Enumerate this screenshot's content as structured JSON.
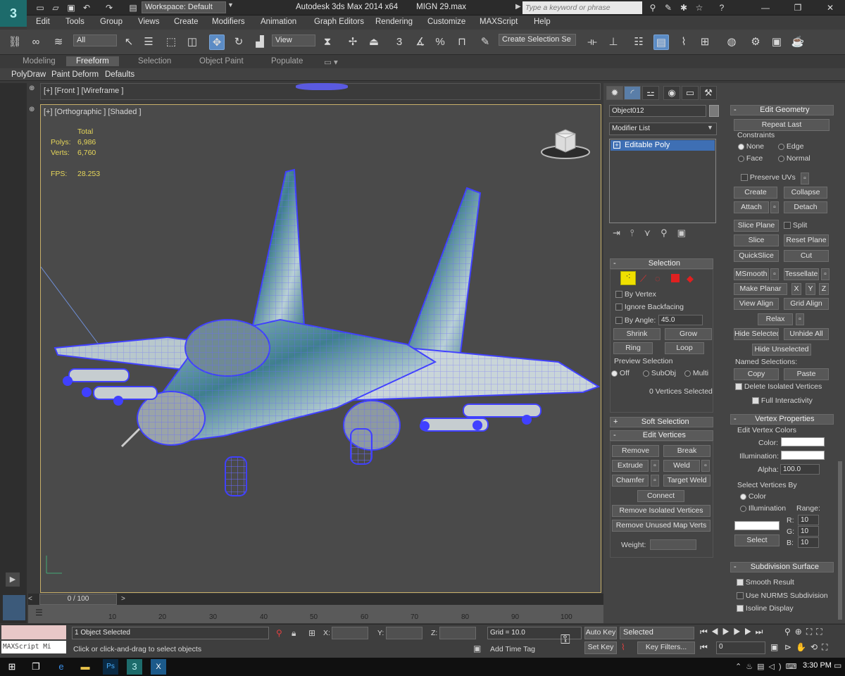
{
  "app": {
    "workspace": "Workspace: Default",
    "window_title": "Autodesk 3ds Max  2014 x64",
    "file": "MIGN 29.max",
    "search_placeholder": "Type a keyword or phrase"
  },
  "menus": [
    "Edit",
    "Tools",
    "Group",
    "Views",
    "Create",
    "Modifiers",
    "Animation",
    "Graph Editors",
    "Rendering",
    "Customize",
    "MAXScript",
    "Help"
  ],
  "toolbar": {
    "selection_filter": "All",
    "ref_coord": "View",
    "named_selection_placeholder": "Create Selection Se",
    "angle_snap": "3",
    "percent_snap": "%"
  },
  "ribbon_tabs": [
    "Modeling",
    "Freeform",
    "Selection",
    "Object Paint",
    "Populate"
  ],
  "ribbon_active": "Freeform",
  "ribbon_sub": [
    "PolyDraw",
    "Paint Deform",
    "Defaults"
  ],
  "viewports": {
    "front_label": "[+] [Front ] [Wireframe ]",
    "main_label": "[+] [Orthographic ] [Shaded ]",
    "stats": {
      "total_label": "Total",
      "polys_label": "Polys:",
      "polys": "6,986",
      "verts_label": "Verts:",
      "verts": "6,760",
      "fps_label": "FPS:",
      "fps": "28.253"
    }
  },
  "command_panel": {
    "object_name": "Object012",
    "modifier_list": "Modifier List",
    "stack_item": "Editable Poly",
    "selection": {
      "title": "Selection",
      "by_vertex": "By Vertex",
      "ignore_backfacing": "Ignore Backfacing",
      "by_angle": "By Angle:",
      "angle_value": "45.0",
      "shrink": "Shrink",
      "grow": "Grow",
      "ring": "Ring",
      "loop": "Loop",
      "preview_title": "Preview Selection",
      "preview_off": "Off",
      "preview_subobj": "SubObj",
      "preview_multi": "Multi",
      "status": "0 Vertices Selected"
    },
    "soft_selection": "Soft Selection",
    "edit_vertices": {
      "title": "Edit Vertices",
      "remove": "Remove",
      "break": "Break",
      "extrude": "Extrude",
      "weld": "Weld",
      "chamfer": "Chamfer",
      "target_weld": "Target Weld",
      "connect": "Connect",
      "remove_isolated": "Remove Isolated Vertices",
      "remove_unused": "Remove Unused Map Verts",
      "weight": "Weight:"
    },
    "edit_geometry": {
      "title": "Edit Geometry",
      "repeat_last": "Repeat Last",
      "constraints": "Constraints",
      "none": "None",
      "edge": "Edge",
      "face": "Face",
      "normal": "Normal",
      "preserve_uvs": "Preserve UVs",
      "create": "Create",
      "collapse": "Collapse",
      "attach": "Attach",
      "detach": "Detach",
      "slice_plane": "Slice Plane",
      "split": "Split",
      "slice": "Slice",
      "reset_plane": "Reset Plane",
      "quickslice": "QuickSlice",
      "cut": "Cut",
      "msmooth": "MSmooth",
      "tessellate": "Tessellate",
      "make_planar": "Make Planar",
      "x": "X",
      "y": "Y",
      "z": "Z",
      "view_align": "View Align",
      "grid_align": "Grid Align",
      "relax": "Relax",
      "hide_selected": "Hide Selected",
      "unhide_all": "Unhide All",
      "hide_unselected": "Hide Unselected",
      "named_selections": "Named Selections:",
      "copy": "Copy",
      "paste": "Paste",
      "delete_isolated": "Delete Isolated Vertices",
      "full_interactivity": "Full Interactivity"
    },
    "vertex_properties": {
      "title": "Vertex Properties",
      "colors_group": "Edit Vertex Colors",
      "color": "Color:",
      "illumination": "Illumination:",
      "alpha": "Alpha:",
      "alpha_value": "100.0",
      "select_by": "Select Vertices By",
      "sel_color": "Color",
      "sel_illum": "Illumination",
      "range": "Range:",
      "r": "R:",
      "g": "G:",
      "b": "B:",
      "r_val": "10",
      "g_val": "10",
      "b_val": "10",
      "select": "Select"
    },
    "subdivision": {
      "title": "Subdivision Surface",
      "smooth_result": "Smooth Result",
      "use_nurms": "Use NURMS Subdivision",
      "isoline": "Isoline Display"
    }
  },
  "timeline": {
    "frame": "0 / 100",
    "ticks": [
      "10",
      "20",
      "30",
      "40",
      "50",
      "60",
      "70",
      "80",
      "90",
      "100"
    ]
  },
  "status": {
    "maxscript": "MAXScript Mi",
    "selected": "1 Object Selected",
    "prompt": "Click or click-and-drag to select objects",
    "x_label": "X:",
    "y_label": "Y:",
    "z_label": "Z:",
    "grid": "Grid = 10.0",
    "add_time_tag": "Add Time Tag",
    "auto_key": "Auto Key",
    "set_key": "Set Key",
    "key_mode": "Selected",
    "key_filters": "Key Filters...",
    "frame_field": "0"
  },
  "taskbar": {
    "time": "3:30 PM"
  },
  "colors": {
    "accent": "#5b8bc4",
    "viewport_border": "#c8b06a",
    "stats_text": "#e6d65a",
    "wire": "#4a4aff"
  }
}
